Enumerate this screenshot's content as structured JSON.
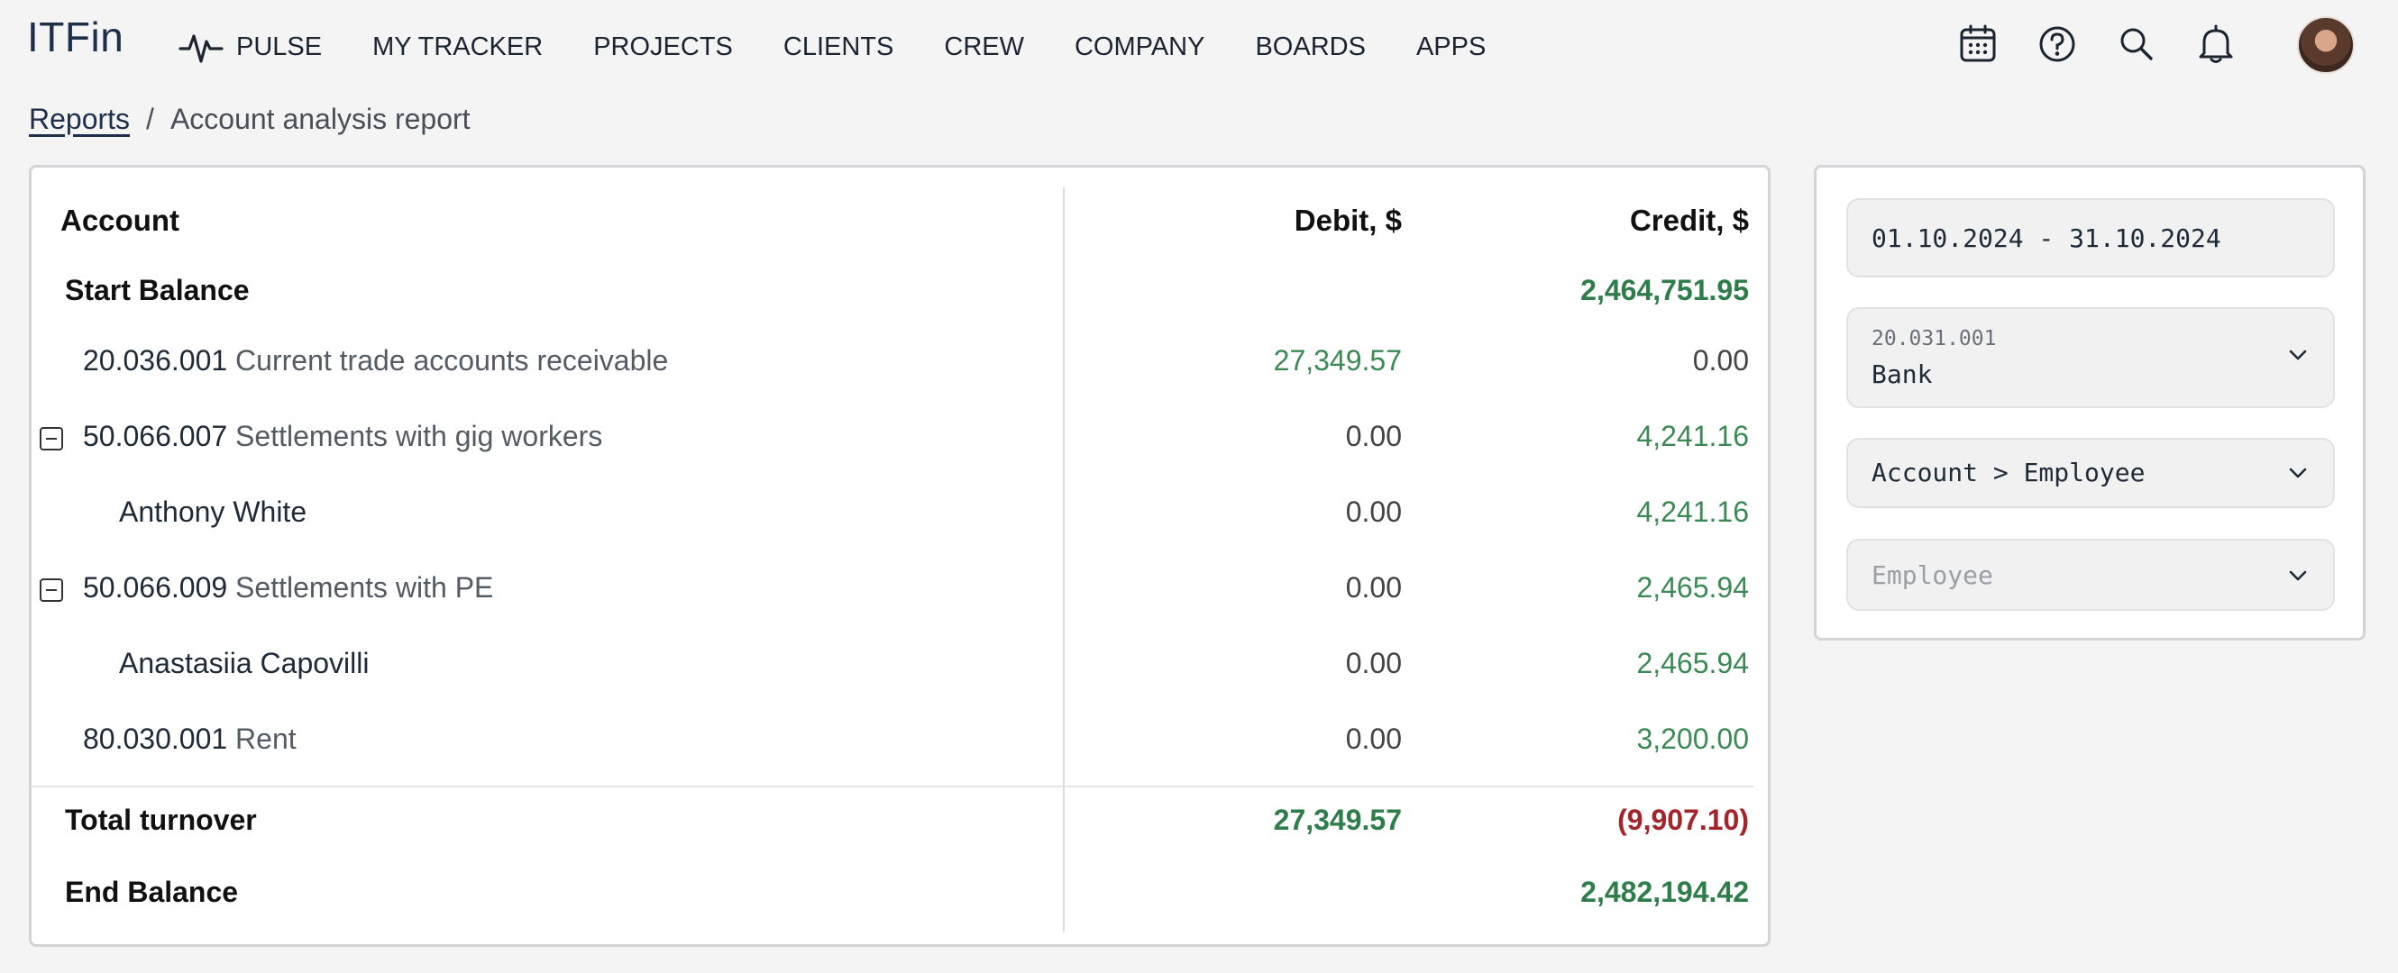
{
  "app": {
    "logo": "ITFin"
  },
  "nav": {
    "items": [
      "PULSE",
      "MY TRACKER",
      "PROJECTS",
      "CLIENTS",
      "CREW",
      "COMPANY",
      "BOARDS",
      "APPS"
    ]
  },
  "top_icons": [
    "calendar-icon",
    "help-icon",
    "search-icon",
    "bell-icon"
  ],
  "breadcrumb": {
    "link": "Reports",
    "separator": "/",
    "current": "Account analysis report"
  },
  "table": {
    "headers": {
      "account": "Account",
      "debit": "Debit, $",
      "credit": "Credit, $"
    },
    "start_balance": {
      "label": "Start Balance",
      "credit": "2,464,751.95"
    },
    "rows": [
      {
        "code": "20.036.001",
        "name": "Current trade accounts receivable",
        "debit": "27,349.57",
        "credit": "0.00"
      },
      {
        "code": "50.066.007",
        "name": "Settlements with gig workers",
        "debit": "0.00",
        "credit": "4,241.16"
      },
      {
        "name": "Anthony White",
        "debit": "0.00",
        "credit": "4,241.16"
      },
      {
        "code": "50.066.009",
        "name": "Settlements with PE",
        "debit": "0.00",
        "credit": "2,465.94"
      },
      {
        "name": "Anastasiia Capovilli",
        "debit": "0.00",
        "credit": "2,465.94"
      },
      {
        "code": "80.030.001",
        "name": "Rent",
        "debit": "0.00",
        "credit": "3,200.00"
      }
    ],
    "total_turnover": {
      "label": "Total turnover",
      "debit": "27,349.57",
      "credit": "(9,907.10)"
    },
    "end_balance": {
      "label": "End Balance",
      "credit": "2,482,194.42"
    }
  },
  "filters": {
    "date_range": "01.10.2024 - 31.10.2024",
    "account": {
      "code": "20.031.001",
      "name": "Bank"
    },
    "grouping": "Account > Employee",
    "employee_placeholder": "Employee"
  },
  "colors": {
    "positive": "#3b8a55",
    "negative": "#a3242a",
    "brand": "#1e2f4a"
  }
}
